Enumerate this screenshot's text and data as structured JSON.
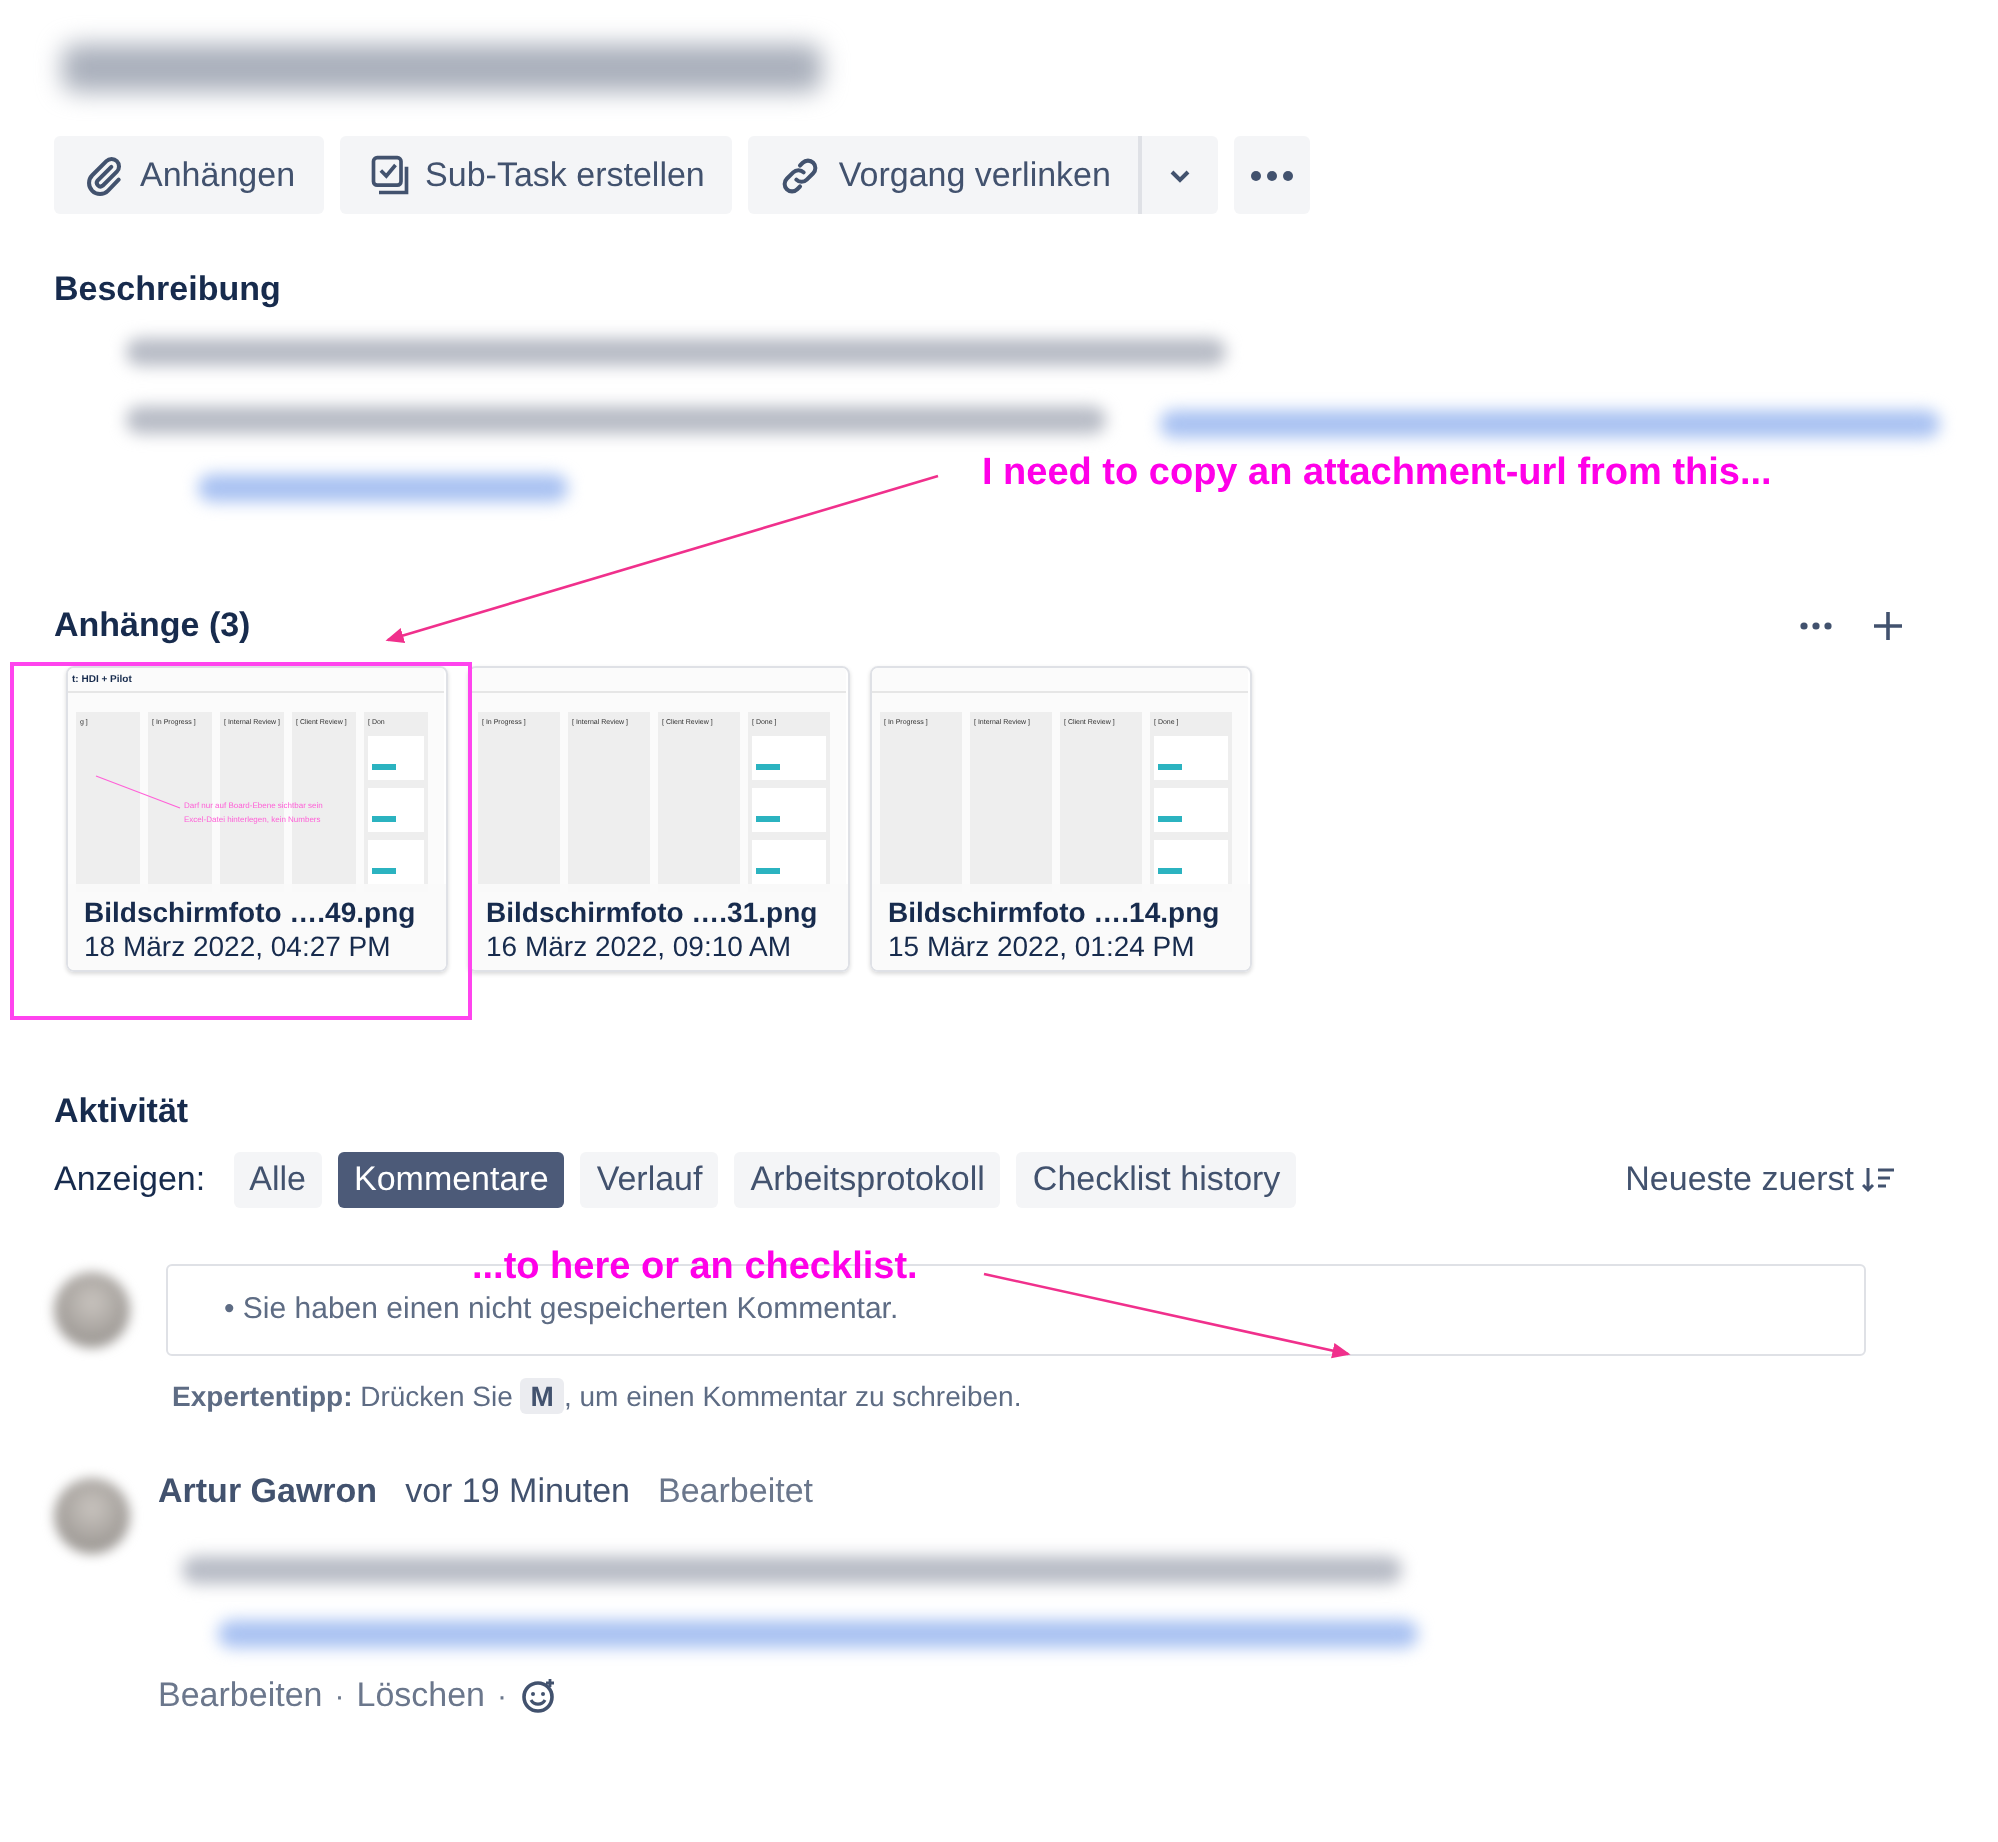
{
  "toolbar": [
    {
      "kind": "attach",
      "label": "Anhängen"
    },
    {
      "kind": "subtask",
      "label": "Sub-Task erstellen"
    },
    {
      "kind": "link",
      "label": "Vorgang verlinken"
    }
  ],
  "description": {
    "heading": "Beschreibung"
  },
  "attachments": {
    "heading": "Anhänge (3)",
    "items": [
      {
        "name": "Bildschirmfoto ….49.png",
        "date": "18 März 2022, 04:27 PM",
        "thumb_title": "t: HDI + Pilot",
        "columns": [
          "g ]",
          "[ In Progress ]",
          "[ Internal Review ]",
          "[ Client Review ]",
          "[ Don"
        ],
        "note": [
          "Darf nur auf Board-Ebene sichtbar sein",
          "Excel-Datei hinterlegen, kein Numbers"
        ]
      },
      {
        "name": "Bildschirmfoto ….31.png",
        "date": "16 März 2022, 09:10 AM",
        "columns": [
          "[ In Progress ]",
          "[ Internal Review ]",
          "[ Client Review ]",
          "[ Done ]"
        ]
      },
      {
        "name": "Bildschirmfoto ….14.png",
        "date": "15 März 2022, 01:24 PM",
        "columns": [
          "[ In Progress ]",
          "[ Internal Review ]",
          "[ Client Review ]",
          "[ Done ]"
        ]
      }
    ]
  },
  "activity": {
    "heading": "Aktivität",
    "filter_label": "Anzeigen:",
    "filters": [
      {
        "label": "Alle",
        "selected": false
      },
      {
        "label": "Kommentare",
        "selected": true
      },
      {
        "label": "Verlauf",
        "selected": false
      },
      {
        "label": "Arbeitsprotokoll",
        "selected": false
      },
      {
        "label": "Checklist history",
        "selected": false
      }
    ],
    "sort": "Neueste zuerst",
    "draft_notice": "• Sie haben einen nicht gespeicherten Kommentar.",
    "tip": {
      "label": "Expertentipp:",
      "before": "Drücken Sie",
      "key": "M",
      "after": ", um einen Kommentar zu schreiben."
    },
    "comment": {
      "author": "Artur Gawron",
      "time": "vor 19 Minuten",
      "edited": "Bearbeitet",
      "actions": [
        {
          "kind": "link",
          "label": "Bearbeiten"
        },
        {
          "kind": "separator",
          "label": "·"
        },
        {
          "kind": "link",
          "label": "Löschen"
        },
        {
          "kind": "separator",
          "label": "·"
        },
        {
          "kind": "emoji"
        }
      ]
    }
  },
  "annotations": [
    {
      "text": "I need to copy an attachment-url from this..."
    },
    {
      "text": "...to here or an checklist."
    }
  ]
}
